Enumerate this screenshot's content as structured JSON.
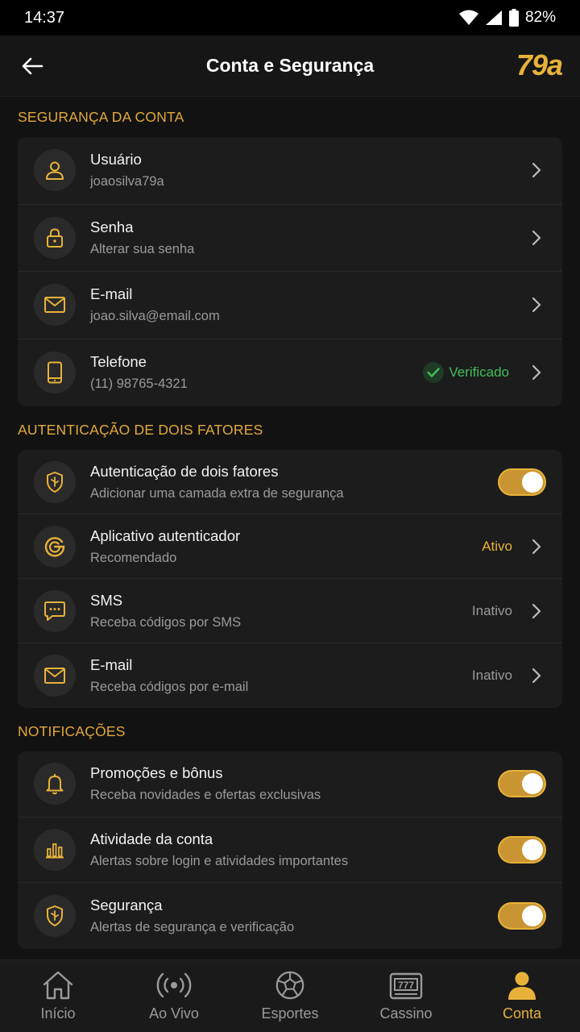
{
  "status_bar": {
    "time": "14:37",
    "battery": "82%"
  },
  "header": {
    "title": "Conta e Segurança",
    "brand": "79a"
  },
  "sections": {
    "account": {
      "title": "SEGURANÇA DA CONTA",
      "items": [
        {
          "title": "Usuário",
          "subtitle": "joaosilva79a"
        },
        {
          "title": "Senha",
          "subtitle": "Alterar sua senha"
        },
        {
          "title": "E-mail",
          "subtitle": "joao.silva@email.com"
        },
        {
          "title": "Telefone",
          "subtitle": "(11) 98765-4321",
          "status": "Verificado"
        }
      ]
    },
    "two_factor": {
      "title": "AUTENTICAÇÃO DE DOIS FATORES",
      "items": [
        {
          "title": "Autenticação de dois fatores",
          "subtitle": "Adicionar uma camada extra de segurança",
          "enabled": true
        },
        {
          "title": "Aplicativo autenticador",
          "subtitle": "Recomendado",
          "status": "Ativo"
        },
        {
          "title": "SMS",
          "subtitle": "Receba códigos por SMS",
          "status": "Inativo"
        },
        {
          "title": "E-mail",
          "subtitle": "Receba códigos por e-mail",
          "status": "Inativo"
        }
      ]
    },
    "notifications": {
      "title": "NOTIFICAÇÕES",
      "items": [
        {
          "title": "Promoções e bônus",
          "subtitle": "Receba novidades e ofertas exclusivas",
          "enabled": true
        },
        {
          "title": "Atividade da conta",
          "subtitle": "Alertas sobre login e atividades importantes",
          "enabled": true
        },
        {
          "title": "Segurança",
          "subtitle": "Alertas de segurança e verificação",
          "enabled": true
        }
      ]
    }
  },
  "bottom_nav": [
    {
      "label": "Início",
      "icon": "home-icon"
    },
    {
      "label": "Ao Vivo",
      "icon": "live-icon"
    },
    {
      "label": "Esportes",
      "icon": "soccer-ball-icon"
    },
    {
      "label": "Cassino",
      "icon": "slot-machine-icon"
    },
    {
      "label": "Conta",
      "icon": "user-icon",
      "active": true
    }
  ],
  "colors": {
    "accent": "#e8b23a",
    "verified": "#3fbf5a",
    "background": "#121212",
    "card": "#1c1c1c"
  }
}
